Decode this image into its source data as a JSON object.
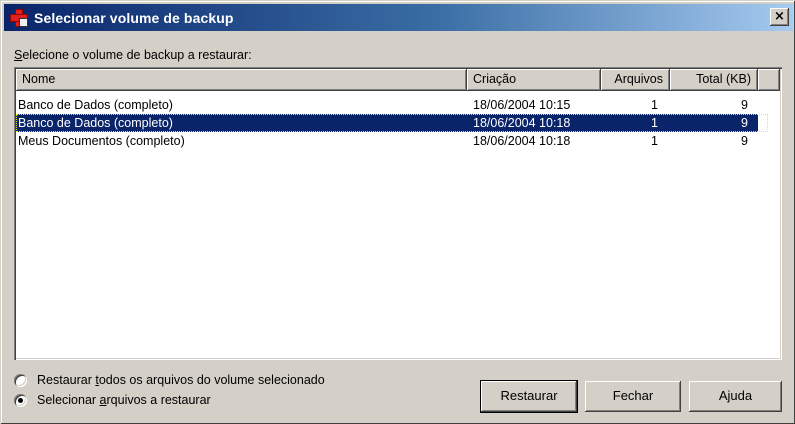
{
  "window": {
    "title": "Selecionar volume de backup",
    "close_label": "×"
  },
  "prompt": {
    "accel": "S",
    "rest": "elecione o volume de backup a restaurar:"
  },
  "table": {
    "columns": [
      "Nome",
      "Criação",
      "Arquivos",
      "Total (KB)"
    ],
    "rows": [
      {
        "nome": "Banco de Dados (completo)",
        "criacao": "18/06/2004 10:15",
        "arquivos": "1",
        "total": "9",
        "selected": false
      },
      {
        "nome": "Banco de Dados (completo)",
        "criacao": "18/06/2004 10:18",
        "arquivos": "1",
        "total": "9",
        "selected": true
      },
      {
        "nome": "Meus Documentos (completo)",
        "criacao": "18/06/2004 10:18",
        "arquivos": "1",
        "total": "9",
        "selected": false
      }
    ]
  },
  "options": {
    "restore_all": {
      "pre": "Restaurar ",
      "accel": "t",
      "post": "odos os arquivos do volume selecionado",
      "checked": false
    },
    "select_files": {
      "pre": "Selecionar ",
      "accel": "a",
      "post": "rquivos a restaurar",
      "checked": true
    }
  },
  "buttons": {
    "restaurar": "Restaurar",
    "fechar": "Fechar",
    "ajuda": "Ajuda"
  },
  "colors": {
    "selection": "#0a246a",
    "titlebar_start": "#0a246a",
    "titlebar_end": "#a6caf0",
    "face": "#d4d0c8"
  }
}
